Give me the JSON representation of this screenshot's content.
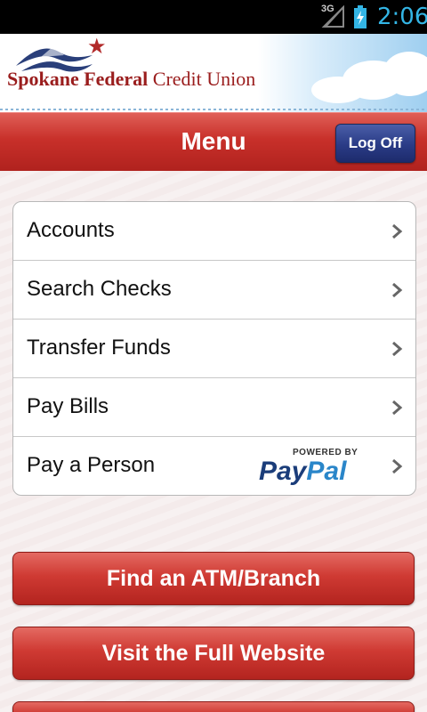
{
  "status_bar": {
    "network": "3G",
    "time": "2:06"
  },
  "header": {
    "logo_bold": "Spokane Federal",
    "logo_regular": "Credit Union"
  },
  "titlebar": {
    "title": "Menu",
    "logoff_label": "Log Off"
  },
  "menu": {
    "items": [
      {
        "label": "Accounts"
      },
      {
        "label": "Search Checks"
      },
      {
        "label": "Transfer Funds"
      },
      {
        "label": "Pay Bills"
      },
      {
        "label": "Pay a Person"
      }
    ],
    "paypal": {
      "powered_by": "POWERED BY",
      "pay": "Pay",
      "pal": "Pal"
    }
  },
  "actions": {
    "find_atm": "Find an ATM/Branch",
    "visit_site": "Visit the Full Website"
  },
  "colors": {
    "brand_red": "#c8302a",
    "logoff_blue": "#2a3b86",
    "status_blue": "#33b5e5"
  }
}
